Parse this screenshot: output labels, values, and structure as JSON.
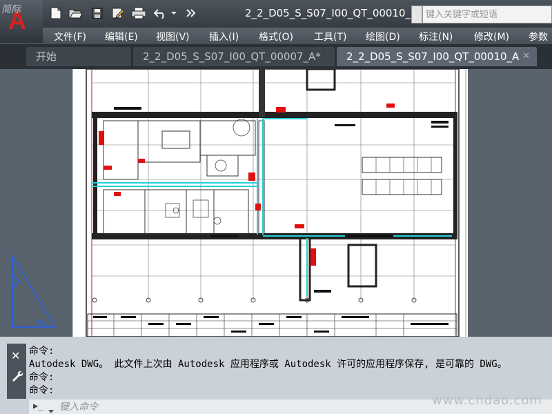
{
  "app": {
    "signature": "简际",
    "logo": "A"
  },
  "title": {
    "document": "2_2_D05_S_S07_I00_QT_00010_..."
  },
  "search": {
    "placeholder": "键入关键字或短语"
  },
  "quick_access": [
    "new-icon",
    "open-icon",
    "save-icon",
    "saveas-icon",
    "plot-icon",
    "undo-icon",
    "dropdown-icon",
    "more-icon"
  ],
  "menubar": {
    "items": [
      "文件(F)",
      "编辑(E)",
      "视图(V)",
      "插入(I)",
      "格式(O)",
      "工具(T)",
      "绘图(D)",
      "标注(N)",
      "修改(M)",
      "参数"
    ]
  },
  "tabs": [
    {
      "label": "开始"
    },
    {
      "label": "2_2_D05_S_S07_I00_QT_00007_A*"
    },
    {
      "label": "2_2_D05_S_S07_I00_QT_00010_A",
      "close": "✕"
    }
  ],
  "command": {
    "history": [
      "命令:",
      "Autodesk DWG。 此文件上次由 Autodesk 应用程序或 Autodesk 许可的应用程序保存, 是可靠的 DWG。",
      "命令:",
      "命令:"
    ],
    "placeholder": "键入命令",
    "close": "✕",
    "prompt": "▶_"
  },
  "watermark": "www.cndao.com",
  "colors": {
    "background": "#59636d",
    "sheet": "#ffffff",
    "cyan_line": "#26d0d8",
    "red_mark": "#e01010",
    "border_highlight": "#FBDE3C"
  }
}
